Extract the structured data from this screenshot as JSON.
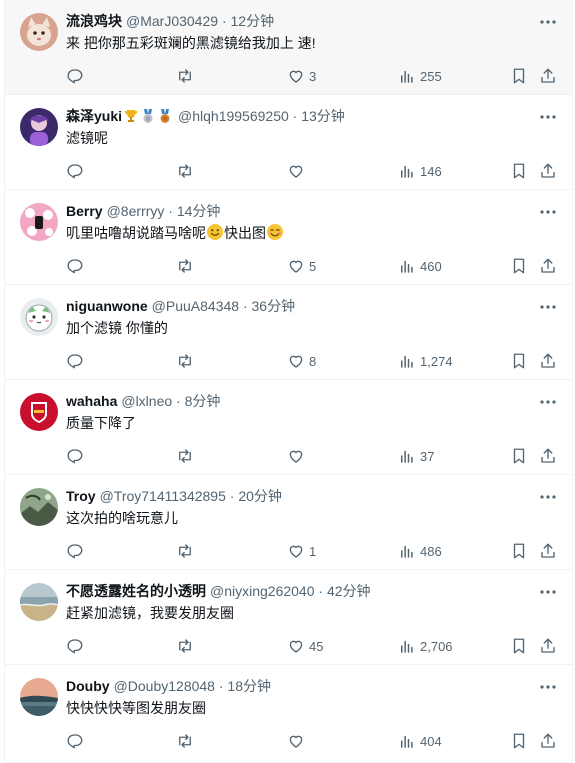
{
  "replies": [
    {
      "name": "流浪鸡块",
      "badges": [],
      "handle": "@MarJ030429",
      "separator": "·",
      "time": "12分钟",
      "text": "来 把你那五彩斑斓的黑滤镜给我加上 速!",
      "emoji": "",
      "likes": "3",
      "views": "255",
      "avatar": {
        "bg": "#d9a48f",
        "icon": "cat-avatar"
      }
    },
    {
      "name": "森泽yuki",
      "badges": [
        "trophy-icon",
        "silver-medal-icon",
        "bronze-medal-icon"
      ],
      "handle": "@hlqh199569250",
      "separator": "·",
      "time": "13分钟",
      "text": "滤镜呢",
      "emoji": "",
      "likes": "",
      "views": "146",
      "avatar": {
        "bg": "#3b2a6b",
        "icon": "anime-avatar"
      }
    },
    {
      "name": "Berry",
      "badges": [],
      "handle": "@8errryy",
      "separator": "·",
      "time": "14分钟",
      "text": "叽里咕噜胡说踏马啥呢",
      "text2": "快出图",
      "emoji": "slightly-smiling-face-icon",
      "emoji2": "smiling-face-icon",
      "likes": "5",
      "views": "460",
      "avatar": {
        "bg": "#f2a7c4",
        "icon": "flower-avatar"
      }
    },
    {
      "name": "niguanwone",
      "badges": [],
      "handle": "@PuuA84348",
      "separator": "·",
      "time": "36分钟",
      "text": "加个滤镜 你懂的",
      "emoji": "",
      "likes": "8",
      "views": "1,274",
      "avatar": {
        "bg": "#e8eef0",
        "icon": "cartoon-avatar"
      }
    },
    {
      "name": "wahaha",
      "badges": [],
      "handle": "@lxlneo",
      "separator": "·",
      "time": "8分钟",
      "text": "质量下降了",
      "emoji": "",
      "likes": "",
      "views": "37",
      "avatar": {
        "bg": "#c8102e",
        "icon": "arsenal-crest-avatar"
      }
    },
    {
      "name": "Troy",
      "badges": [],
      "handle": "@Troy71411342895",
      "separator": "·",
      "time": "20分钟",
      "text": "这次拍的啥玩意儿",
      "emoji": "",
      "likes": "1",
      "views": "486",
      "avatar": {
        "bg": "#5c6b55",
        "icon": "landscape-avatar"
      }
    },
    {
      "name": "不愿透露姓名的小透明",
      "badges": [],
      "handle": "@niyxing262040",
      "separator": "·",
      "time": "42分钟",
      "text": "赶紧加滤镜，我要发朋友圈",
      "emoji": "",
      "likes": "45",
      "views": "2,706",
      "avatar": {
        "bg": "#c9b48a",
        "icon": "beach-avatar"
      }
    },
    {
      "name": "Douby",
      "badges": [],
      "handle": "@Douby128048",
      "separator": "·",
      "time": "18分钟",
      "text": "快快快快等图发朋友圈",
      "emoji": "",
      "likes": "",
      "views": "404",
      "avatar": {
        "bg": "#e7a98f",
        "icon": "sunset-avatar"
      }
    }
  ],
  "colors": {
    "text": "#0f1419",
    "muted": "#536471",
    "border": "#eff3f4",
    "first_row_bg": "#f7f7f7"
  }
}
